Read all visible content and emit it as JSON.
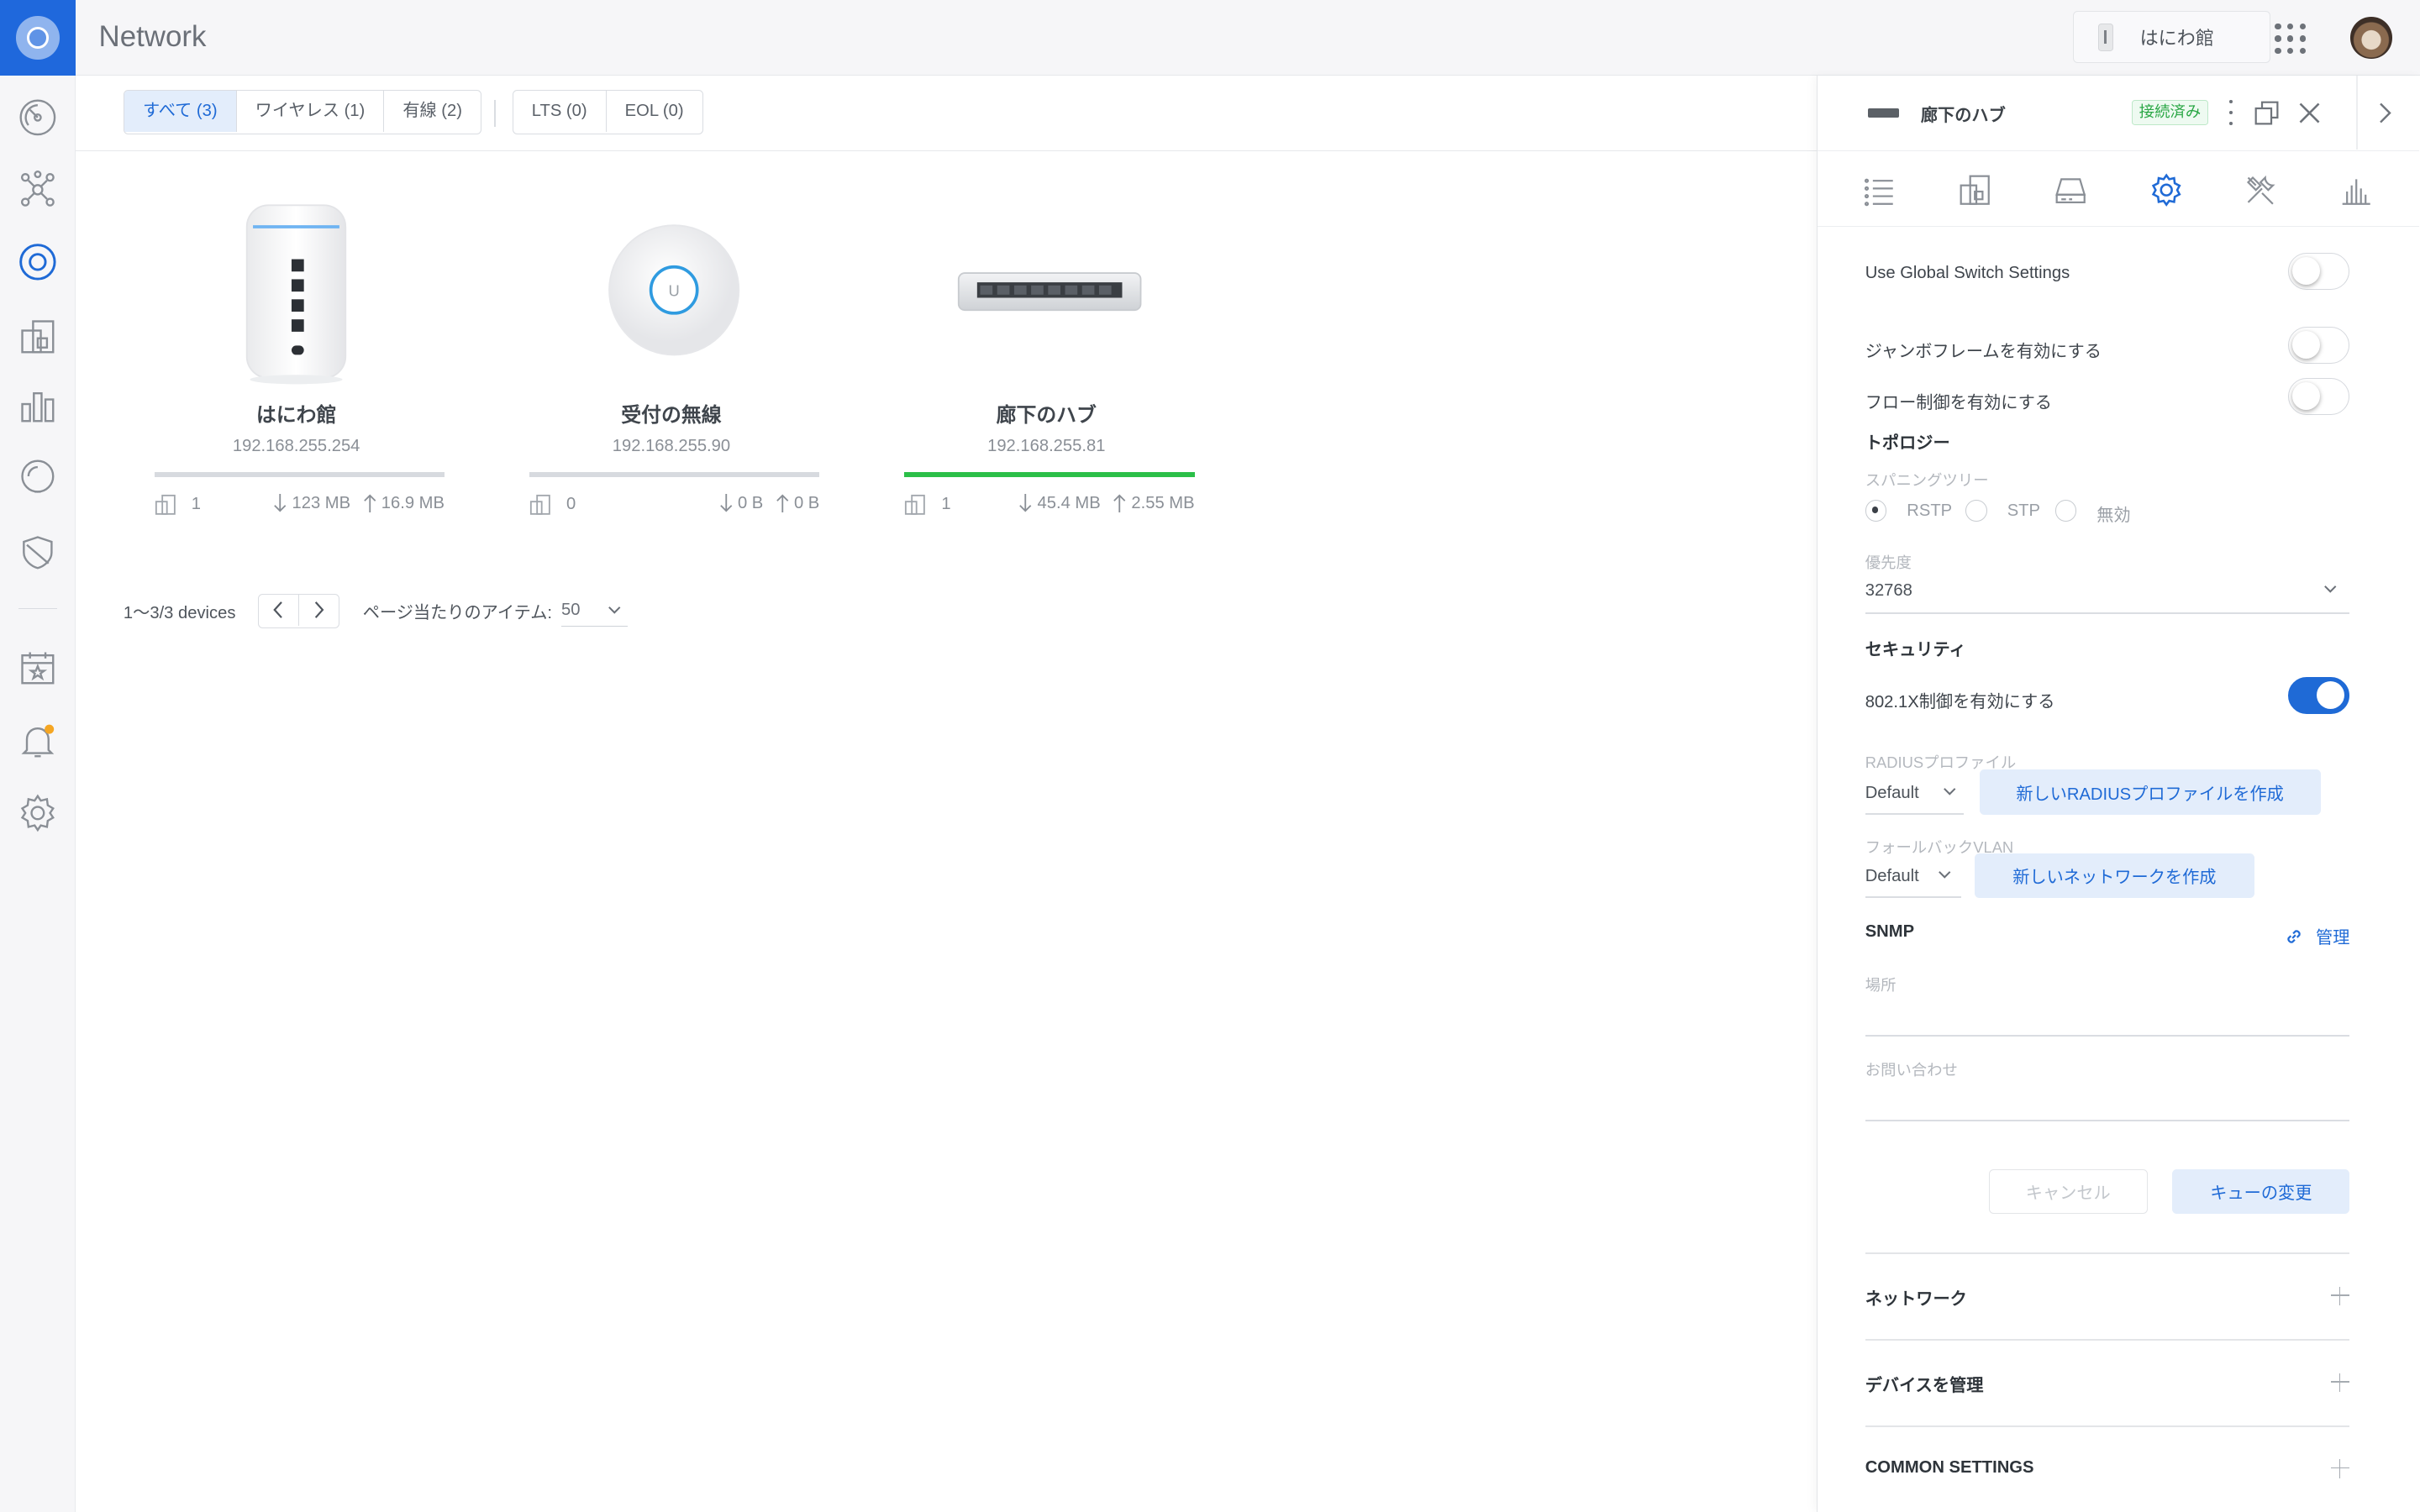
{
  "app": {
    "title": "Network"
  },
  "topbar": {
    "site_name": "はにわ館"
  },
  "filters": {
    "group1": [
      "すべて (3)",
      "ワイヤレス (1)",
      "有線 (2)"
    ],
    "group2": [
      "LTS (0)",
      "EOL (0)"
    ]
  },
  "devices": [
    {
      "name": "はにわ館",
      "ip": "192.168.255.254",
      "clients": "1",
      "down": "123 MB",
      "up": "16.9 MB",
      "type": "gateway",
      "status_color": "#d7dadf"
    },
    {
      "name": "受付の無線",
      "ip": "192.168.255.90",
      "clients": "0",
      "down": "0 B",
      "up": "0 B",
      "type": "access-point",
      "status_color": "#d7dadf"
    },
    {
      "name": "廊下のハブ",
      "ip": "192.168.255.81",
      "clients": "1",
      "down": "45.4 MB",
      "up": "2.55 MB",
      "type": "switch",
      "status_color": "#2bbf48"
    }
  ],
  "pagination": {
    "count": "1〜3/3 devices",
    "items_per_page_label": "ページ当たりのアイテム:",
    "items_per_page": "50"
  },
  "panel": {
    "device_name": "廊下のハブ",
    "status": "接続済み",
    "settings": {
      "global_switch": "Use Global Switch Settings",
      "jumbo": "ジャンボフレームを有効にする",
      "flow": "フロー制御を有効にする",
      "topology": "トポロジー",
      "spanning_tree": "スパニングツリー",
      "radio_rstp": "RSTP",
      "radio_stp": "STP",
      "radio_off": "無効",
      "priority_label": "優先度",
      "priority_value": "32768",
      "security": "セキュリティ",
      "dot1x": "802.1X制御を有効にする",
      "radius_label": "RADIUSプロファイル",
      "radius_value": "Default",
      "radius_button": "新しいRADIUSプロファイルを作成",
      "fallback_label": "フォールバックVLAN",
      "fallback_value": "Default",
      "fallback_button": "新しいネットワークを作成",
      "snmp": "SNMP",
      "manage": "管理",
      "location_label": "場所",
      "contact_label": "お問い合わせ",
      "cancel": "キャンセル",
      "queue": "キューの変更",
      "network_section": "ネットワーク",
      "manage_device_section": "デバイスを管理",
      "common_section": "COMMON SETTINGS"
    },
    "toggles": {
      "global_switch": false,
      "jumbo": false,
      "flow": false,
      "dot1x": true
    }
  },
  "colors": {
    "accent": "#1f6ad6",
    "online": "#2bbf48",
    "notification_dot": "#f5a623"
  }
}
